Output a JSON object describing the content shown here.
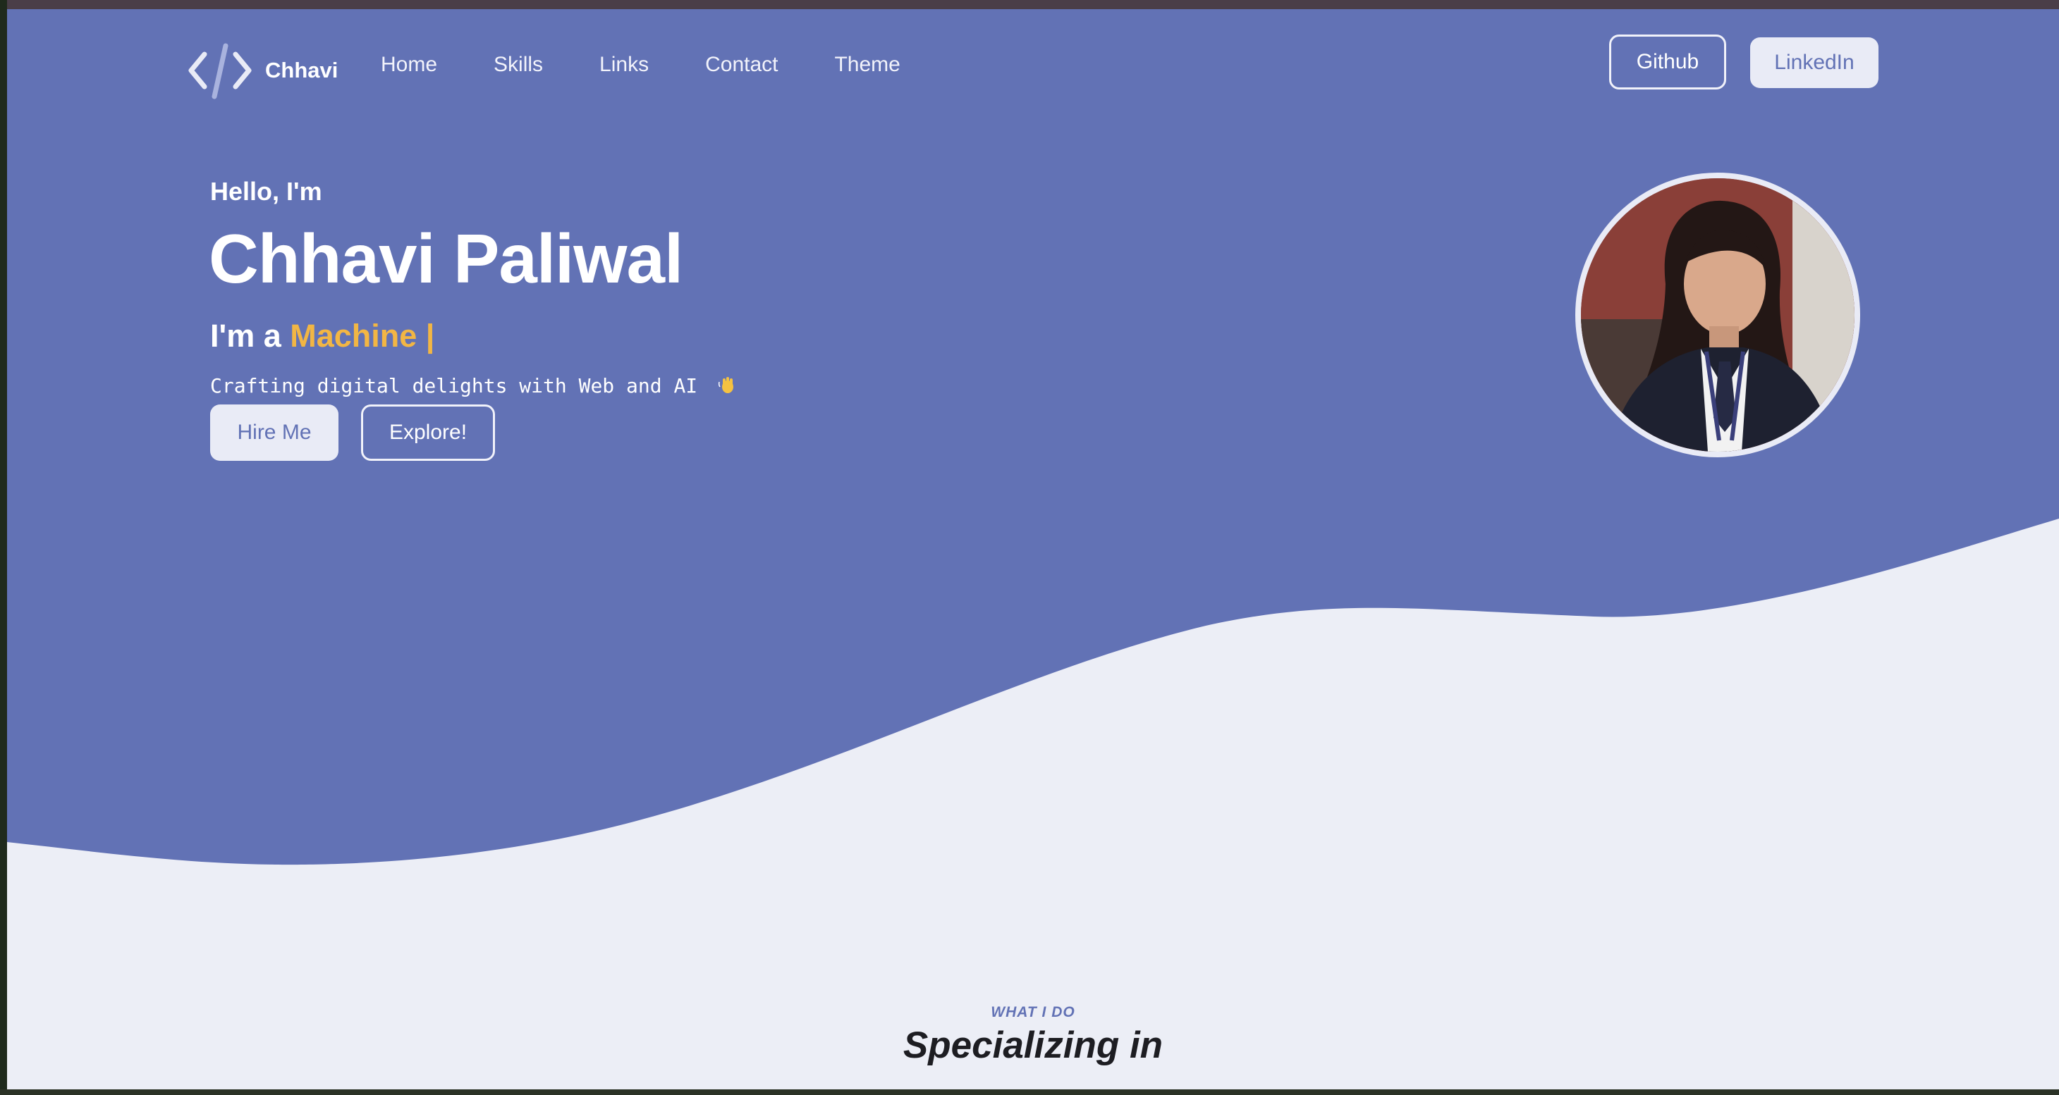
{
  "colors": {
    "primary": "#6272B5",
    "light_bg": "#ECEEF6",
    "accent": "#F2B644",
    "text_dark": "#1D1D22"
  },
  "nav": {
    "brand": "Chhavi",
    "brand_icon": "code-brackets-icon",
    "links": [
      "Home",
      "Skills",
      "Links",
      "Contact",
      "Theme"
    ],
    "github_label": "Github",
    "linkedin_label": "LinkedIn"
  },
  "hero": {
    "greeting": "Hello, I'm",
    "name": "Chhavi Paliwal",
    "role_prefix": "I'm a",
    "role_word": "Machine |",
    "tagline": "Crafting digital delights with Web and AI",
    "tagline_icon": "waving-hand-icon",
    "hire_label": "Hire Me",
    "explore_label": "Explore!"
  },
  "specializing": {
    "kicker": "WHAT I DO",
    "title": "Specializing in"
  }
}
